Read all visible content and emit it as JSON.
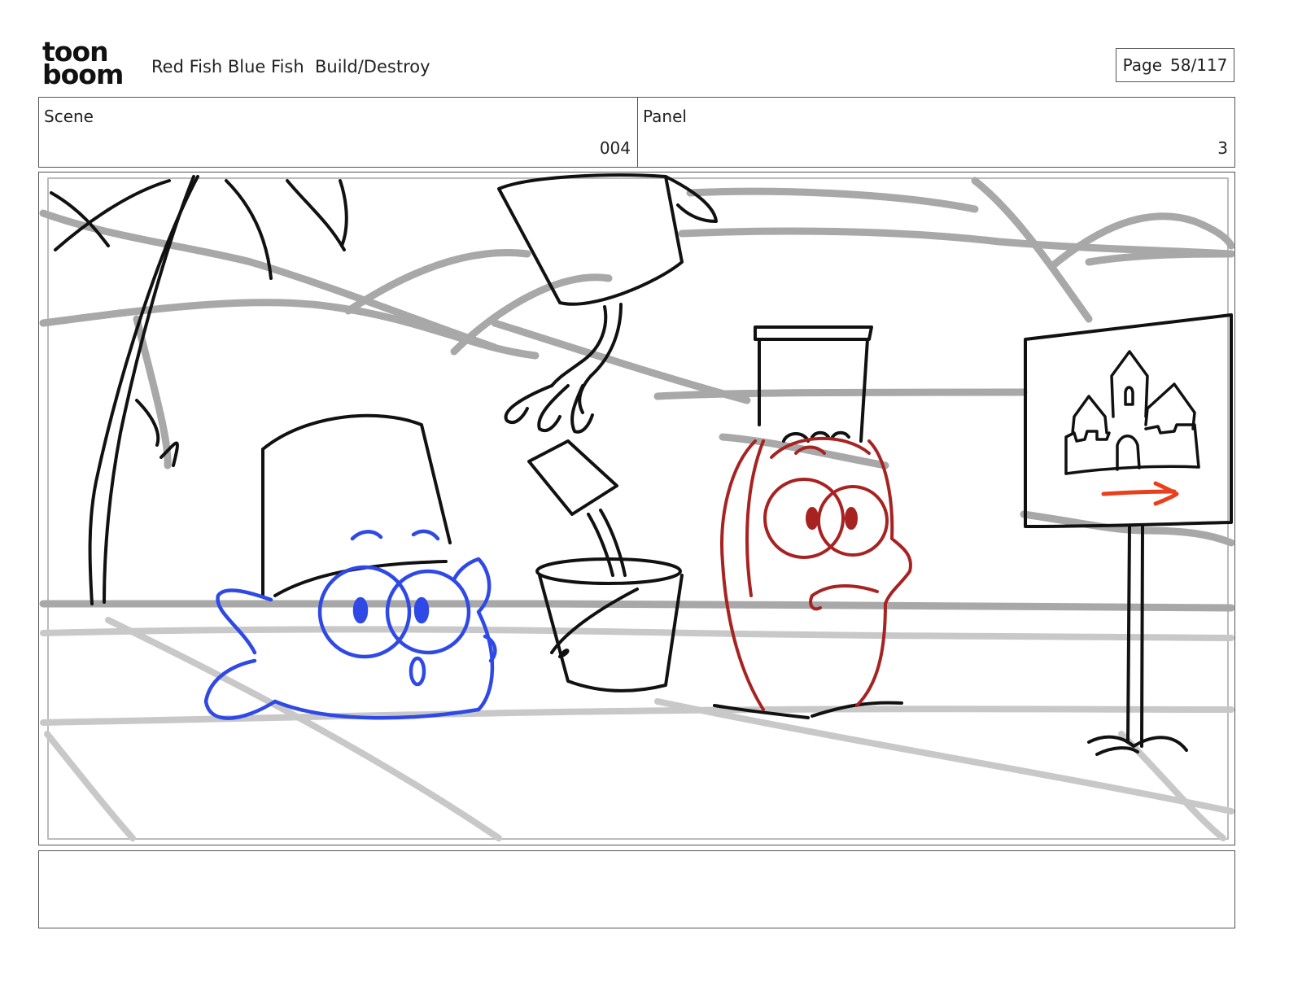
{
  "header": {
    "logo_top": "toon",
    "logo_bottom": "boom",
    "project_title": "Red Fish Blue Fish  Build/Destroy",
    "page_label": "Page",
    "page_value": "58/117"
  },
  "scene": {
    "label": "Scene",
    "value": "004"
  },
  "panel": {
    "label": "Panel",
    "value": "3"
  },
  "drawing": {
    "colors": {
      "blue_fish": "#2f49e6",
      "red_fish": "#a62322",
      "arrow": "#e8401c",
      "background_lines": "#a8a8a8",
      "ink": "#111111"
    },
    "icons": [
      "palm-tree",
      "bucket",
      "claw-arm",
      "blue-fish",
      "red-fish",
      "sign-post",
      "castle-icon",
      "arrow-icon"
    ]
  },
  "caption": {
    "text": ""
  }
}
